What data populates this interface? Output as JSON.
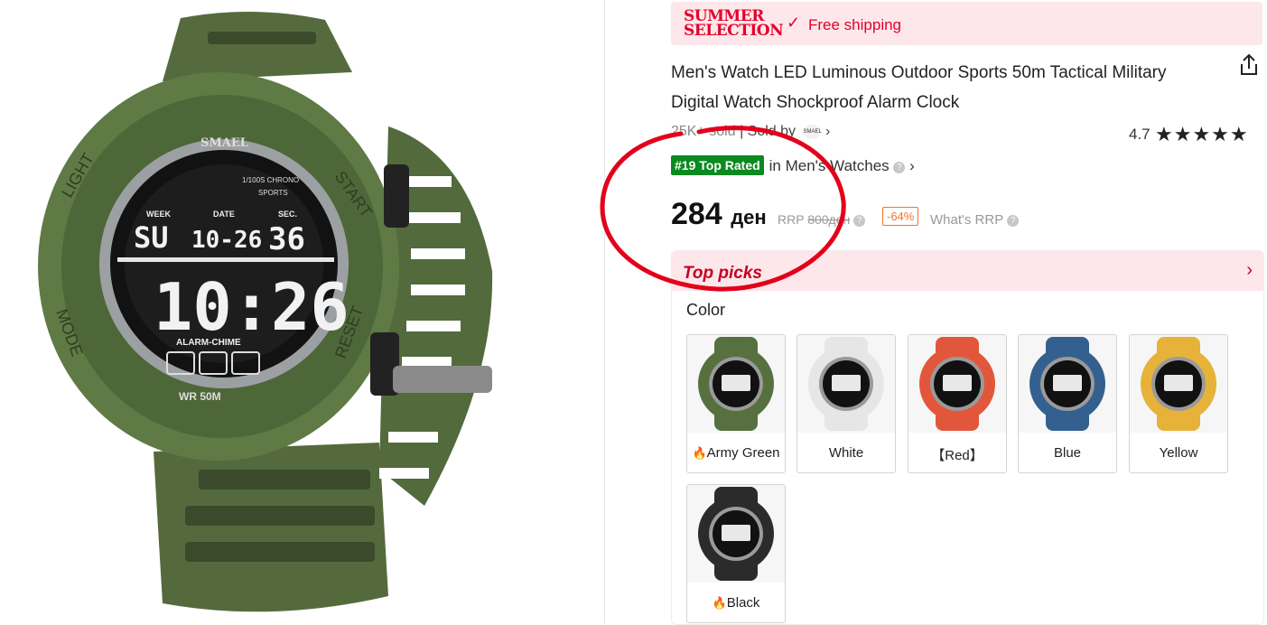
{
  "banner": {
    "logo_line1": "SUMMER",
    "logo_line2": "SELECTION",
    "text": "Free shipping"
  },
  "product": {
    "title_line1": "Men's Watch LED Luminous Outdoor Sports 50m Tactical Military",
    "title_line2": "Digital Watch Shockproof Alarm Clock",
    "sold": "25K+ sold",
    "sold_by_label": "| Sold by",
    "brand_badge": "SMAEL",
    "rating": "4.7",
    "rank_badge": "#19 Top Rated",
    "rank_category": "in Men's Watches",
    "price": "284",
    "currency": "ден",
    "rrp_label": "RRP",
    "rrp_value": "800ден",
    "discount": "-64%",
    "whats_rrp": "What's RRP"
  },
  "watch_face": {
    "brand": "SMAEL",
    "left_label": "LIGHT",
    "right_label": "START",
    "bottom_left_label": "MODE",
    "bottom_right_label": "RESET",
    "week_label": "WEEK",
    "date_label": "DATE",
    "sec_label": "SEC.",
    "day": "SU",
    "date": "10-26",
    "seconds": "36",
    "time": "10:26",
    "chrono": "1/100S CHRONO",
    "sports": "SPORTS",
    "alarm": "ALARM-CHIME",
    "wr": "WR 50M"
  },
  "top_picks": {
    "title": "Top picks",
    "color_label": "Color",
    "colors": [
      {
        "name": "Army Green",
        "hex": "#56703f",
        "icon": "flame"
      },
      {
        "name": "White",
        "hex": "#e6e6e6"
      },
      {
        "name": "【Red】",
        "hex": "#e2573c"
      },
      {
        "name": "Blue",
        "hex": "#34608f"
      },
      {
        "name": "Yellow",
        "hex": "#e6b23a"
      },
      {
        "name": "Black",
        "hex": "#2b2b2b",
        "icon": "flame"
      }
    ]
  },
  "colors": {
    "accent_red": "#e4002b",
    "rank_green": "#0a8a1f",
    "discount_orange": "#f57224",
    "annotation_red": "#e3001b"
  }
}
